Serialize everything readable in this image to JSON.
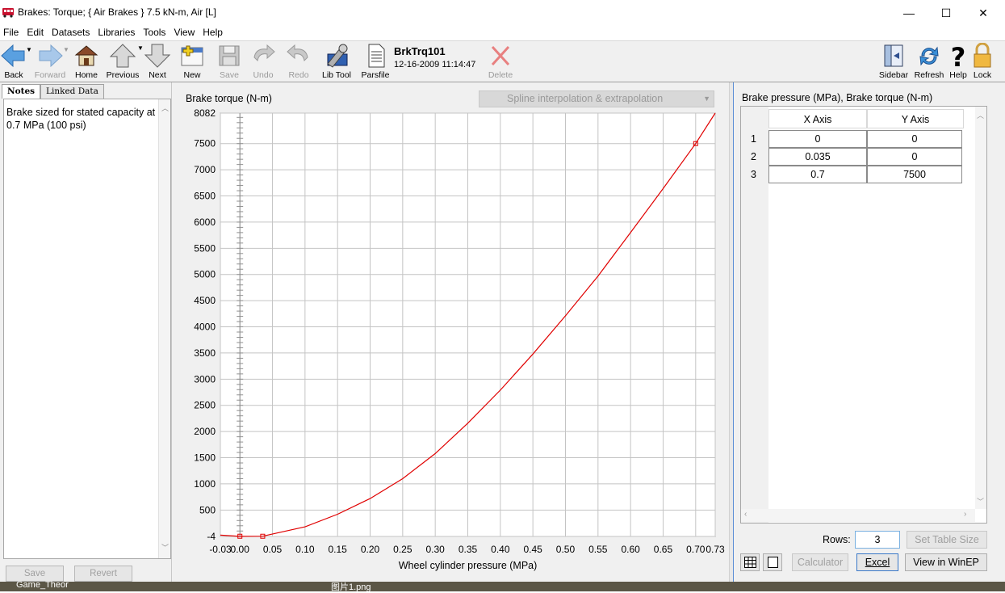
{
  "window": {
    "title": "Brakes: Torque;   { Air Brakes }   7.5 kN-m, Air [L]",
    "min_glyph": "—",
    "max_glyph": "☐",
    "close_glyph": "✕"
  },
  "menu": [
    "File",
    "Edit",
    "Datasets",
    "Libraries",
    "Tools",
    "View",
    "Help"
  ],
  "toolbar": {
    "back": "Back",
    "forward": "Forward",
    "home": "Home",
    "previous": "Previous",
    "next": "Next",
    "new": "New",
    "save": "Save",
    "undo": "Undo",
    "redo": "Redo",
    "lib_tool": "Lib Tool",
    "parsfile": "Parsfile",
    "dataset_name": "BrkTrq101",
    "dataset_date": "12-16-2009 11:14:47",
    "delete": "Delete",
    "sidebar": "Sidebar",
    "refresh": "Refresh",
    "help": "Help",
    "lock": "Lock"
  },
  "left_panel": {
    "tabs": [
      "Notes",
      "Linked Data"
    ],
    "notes": "Brake sized for stated capacity at 0.7 MPa (100 psi)",
    "save_button": "Save",
    "revert_button": "Revert"
  },
  "center": {
    "interp_dropdown": "Spline interpolation & extrapolation"
  },
  "chart_data": {
    "type": "line",
    "ylabel": "Brake torque (N-m)",
    "xlabel": "Wheel cylinder pressure (MPa)",
    "xlim": [
      -0.03,
      0.73
    ],
    "ylim": [
      -4,
      8082
    ],
    "x_ticks": [
      "-0.03",
      "0.00",
      "0.05",
      "0.10",
      "0.15",
      "0.20",
      "0.25",
      "0.30",
      "0.35",
      "0.40",
      "0.45",
      "0.50",
      "0.55",
      "0.60",
      "0.65",
      "0.70",
      "0.73"
    ],
    "y_ticks": [
      "-4",
      "500",
      "1000",
      "1500",
      "2000",
      "2500",
      "3000",
      "3500",
      "4000",
      "4500",
      "5000",
      "5500",
      "6000",
      "6500",
      "7000",
      "7500",
      "8082"
    ],
    "points": [
      [
        0,
        0
      ],
      [
        0.035,
        0
      ],
      [
        0.7,
        7500
      ]
    ],
    "curve": [
      [
        -0.03,
        20
      ],
      [
        0.0,
        -2
      ],
      [
        0.035,
        0
      ],
      [
        0.1,
        180
      ],
      [
        0.15,
        420
      ],
      [
        0.2,
        720
      ],
      [
        0.25,
        1100
      ],
      [
        0.3,
        1580
      ],
      [
        0.35,
        2160
      ],
      [
        0.4,
        2790
      ],
      [
        0.45,
        3480
      ],
      [
        0.5,
        4210
      ],
      [
        0.55,
        4970
      ],
      [
        0.6,
        5800
      ],
      [
        0.65,
        6640
      ],
      [
        0.7,
        7500
      ],
      [
        0.73,
        8082
      ]
    ],
    "grid": true,
    "color": "#e00000"
  },
  "right_panel": {
    "table_title": "Brake pressure (MPa), Brake torque (N-m)",
    "col_x": "X Axis",
    "col_y": "Y Axis",
    "rows": [
      {
        "n": "1",
        "x": "0",
        "y": "0"
      },
      {
        "n": "2",
        "x": "0.035",
        "y": "0"
      },
      {
        "n": "3",
        "x": "0.7",
        "y": "7500"
      }
    ],
    "rows_label": "Rows:",
    "rows_value": "3",
    "set_table_size": "Set Table Size",
    "calculator": "Calculator",
    "excel": "Excel",
    "view_winep": "View in WinEP"
  },
  "taskbar": {
    "item1": "Game_Theor",
    "item2": "图片1.png"
  }
}
